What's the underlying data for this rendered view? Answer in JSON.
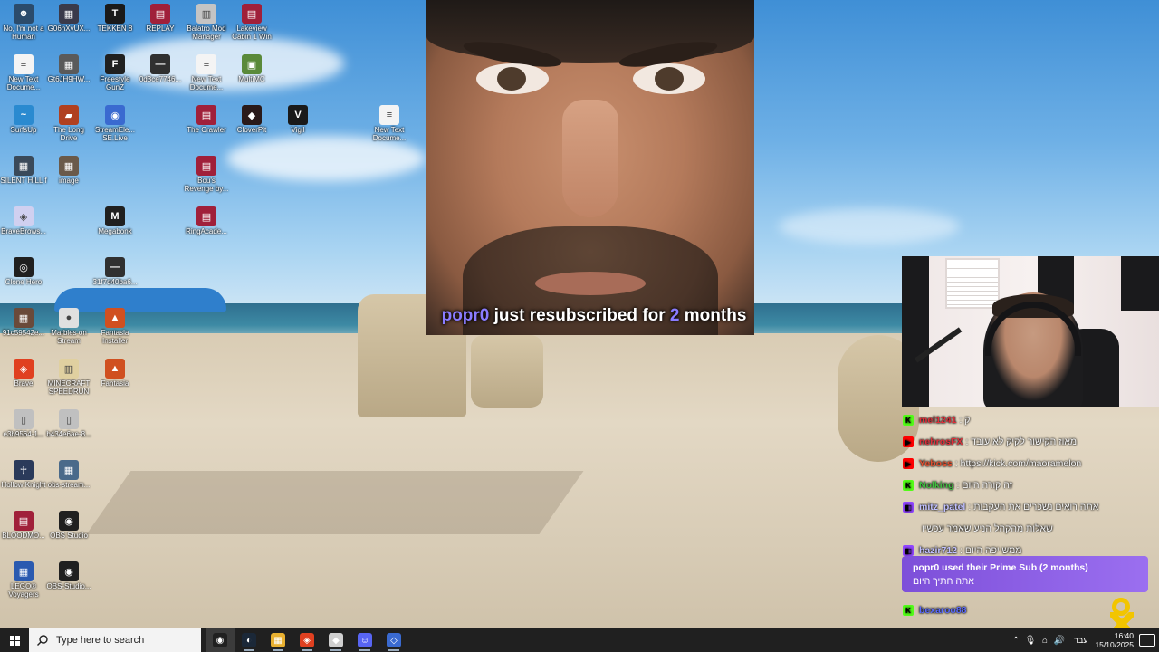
{
  "desktop": {
    "icons": [
      {
        "label": "No, I'm not a Human",
        "color": "#2b4b6b",
        "glyph": "☻"
      },
      {
        "label": "G06hXvUX...",
        "color": "#3a3a4a",
        "glyph": "▦"
      },
      {
        "label": "TEKKEN 8",
        "color": "#1a1a1a",
        "glyph": "T"
      },
      {
        "label": "REPLAY",
        "color": "#a0203a",
        "glyph": "▤"
      },
      {
        "label": "Balatro Mod Manager",
        "color": "#c4c4c4",
        "glyph": "▥"
      },
      {
        "label": "Lakeview Cabin 1 Win",
        "color": "#a0203a",
        "glyph": "▤"
      },
      {
        "label": "New Text Docume...",
        "color": "#f4f4f4",
        "glyph": "≡"
      },
      {
        "label": "Gt6JH9HW...",
        "color": "#5a5a5a",
        "glyph": "▦"
      },
      {
        "label": "Freestyle GunZ",
        "color": "#202020",
        "glyph": "F"
      },
      {
        "label": "0d3ce7746...",
        "color": "#303030",
        "glyph": "—"
      },
      {
        "label": "New Text Docume...",
        "color": "#f4f4f4",
        "glyph": "≡"
      },
      {
        "label": "MultiMC",
        "color": "#5a8a3a",
        "glyph": "▣"
      },
      {
        "label": "SurfsUp",
        "color": "#2a8ad0",
        "glyph": "~"
      },
      {
        "label": "The Long Drive",
        "color": "#b04020",
        "glyph": "▰"
      },
      {
        "label": "StreamEle... SE.Live",
        "color": "#3a6ad0",
        "glyph": "◉"
      },
      {
        "label": "The Crawler",
        "color": "#a0203a",
        "glyph": "▤"
      },
      {
        "label": "CloverPit",
        "color": "#2a1a1a",
        "glyph": "◆"
      },
      {
        "label": "Vigil",
        "color": "#1a1a1a",
        "glyph": "V"
      },
      {
        "label": "New Text Docume...",
        "color": "#f4f4f4",
        "glyph": "≡"
      },
      {
        "label": "SILENT HILL f",
        "color": "#3a4a5a",
        "glyph": "▦"
      },
      {
        "label": "image",
        "color": "#6a5a4a",
        "glyph": "▦"
      },
      {
        "label": "Bou's Revenge by...",
        "color": "#a0203a",
        "glyph": "▤"
      },
      {
        "label": "BraveBrows...",
        "color": "#d0d0f0",
        "glyph": "◈"
      },
      {
        "label": "Megabonk",
        "color": "#202020",
        "glyph": "M"
      },
      {
        "label": "RingAcade...",
        "color": "#a0203a",
        "glyph": "▤"
      },
      {
        "label": "Clone Hero",
        "color": "#202020",
        "glyph": "◎"
      },
      {
        "label": "31f7d40ba6...",
        "color": "#303030",
        "glyph": "—"
      },
      {
        "label": "91c59542e...",
        "color": "#6a4a3a",
        "glyph": "▦"
      },
      {
        "label": "Marbles on Stream",
        "color": "#e0e0e0",
        "glyph": "●"
      },
      {
        "label": "Fantasia Installer",
        "color": "#d05020",
        "glyph": "▲"
      },
      {
        "label": "Brave",
        "color": "#e04020",
        "glyph": "◈"
      },
      {
        "label": "MINECRAFT SPEEDRUN",
        "color": "#e0d0a0",
        "glyph": "▥"
      },
      {
        "label": "Fantasia",
        "color": "#d05020",
        "glyph": "▲"
      },
      {
        "label": "e3b9564-1...",
        "color": "#c0c0c0",
        "glyph": "▯"
      },
      {
        "label": "b434e6ae-8...",
        "color": "#c0c0c0",
        "glyph": "▯"
      },
      {
        "label": "Hollow Knight",
        "color": "#2a3a5a",
        "glyph": "☥"
      },
      {
        "label": "obs-stream...",
        "color": "#4a6a8a",
        "glyph": "▦"
      },
      {
        "label": "BLOODMO...",
        "color": "#a0203a",
        "glyph": "▤"
      },
      {
        "label": "OBS Studio",
        "color": "#202020",
        "glyph": "◉"
      },
      {
        "label": "LEGO® Voyagers",
        "color": "#2a5ab0",
        "glyph": "▦"
      },
      {
        "label": "OBS-Studio...",
        "color": "#202020",
        "glyph": "◉"
      }
    ]
  },
  "overlay": {
    "alert_user": "popr0",
    "alert_mid": " just resubscribed for ",
    "alert_count": "2",
    "alert_end": " months"
  },
  "chat": {
    "messages": [
      {
        "platform": "K",
        "platform_color": "#53fc18",
        "user": "mel1241",
        "user_color": "#e0303a",
        "text": ": ק"
      },
      {
        "platform": "▶",
        "platform_color": "#ff0000",
        "user": "nehrosFX",
        "user_color": "#e0303a",
        "text": ": מאוז הקישור לקיק לא עובד"
      },
      {
        "platform": "▶",
        "platform_color": "#ff0000",
        "user": "Yeboss",
        "user_color": "#e05030",
        "text": ": https://kick.com/maoramelon"
      },
      {
        "platform": "K",
        "platform_color": "#53fc18",
        "user": "Nolking",
        "user_color": "#40c040",
        "text": ": זה קורה היום"
      },
      {
        "platform": "◧",
        "platform_color": "#9146ff",
        "user": "mitz_patel",
        "user_color": "#c0c0ff",
        "text": ": אתה רואים נשכרים את העקבות"
      },
      {
        "platform": "",
        "platform_color": "transparent",
        "user": "",
        "user_color": "#ffffff",
        "text": "שאלות מהקהל הניע שאמר עכשיו"
      },
      {
        "platform": "◧",
        "platform_color": "#9146ff",
        "user": "hazir712",
        "user_color": "#c0c0ff",
        "text": ": ממש יפה היום"
      }
    ],
    "prime_title": "popr0 used their Prime Sub (2 months)",
    "prime_message": "אתה חתיך היום",
    "last_user": "bexaroo88",
    "last_platform": "K"
  },
  "taskbar": {
    "search_placeholder": "Type here to search",
    "apps": [
      {
        "name": "obs",
        "color": "#202020",
        "glyph": "◉",
        "state": "active"
      },
      {
        "name": "steam",
        "color": "#1b2838",
        "glyph": "◐",
        "state": "running"
      },
      {
        "name": "file-explorer",
        "color": "#e8b030",
        "glyph": "▦",
        "state": "running"
      },
      {
        "name": "brave",
        "color": "#e04020",
        "glyph": "◈",
        "state": "running"
      },
      {
        "name": "streamer-bot",
        "color": "#d0d0d0",
        "glyph": "◆",
        "state": "running"
      },
      {
        "name": "discord",
        "color": "#5865f2",
        "glyph": "☺",
        "state": "running"
      },
      {
        "name": "notes",
        "color": "#3a6ad0",
        "glyph": "◇",
        "state": "running"
      }
    ],
    "lang": "עבר",
    "time": "16:40",
    "date": "15/10/2025"
  }
}
